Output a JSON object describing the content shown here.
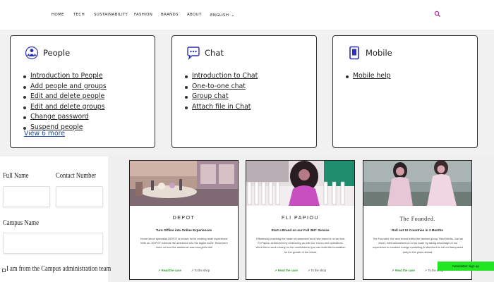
{
  "nav": {
    "items": [
      "HOME",
      "TECH",
      "SUSTAINABILITY",
      "FASHION",
      "BRANDS",
      "ABOUT"
    ],
    "language": "ENGLISH",
    "icons": {
      "search": "search-icon",
      "language": "chevron-down-icon"
    }
  },
  "help": {
    "cards": [
      {
        "title": "People",
        "icon": "people-icon",
        "links": [
          "Introduction to People",
          "Add people and groups",
          "Edit and delete people",
          "Edit and delete groups",
          "Change password",
          "Suspend people"
        ],
        "more": "View 6 more"
      },
      {
        "title": "Chat",
        "icon": "chat-bubble-icon",
        "links": [
          "Introduction to Chat",
          "One-to-one chat",
          "Group chat",
          "Attach file in Chat"
        ]
      },
      {
        "title": "Mobile",
        "icon": "mobile-icon",
        "links": [
          "Mobile help"
        ]
      }
    ]
  },
  "form": {
    "full_name": "Full Name",
    "contact_number": "Contact Number",
    "campus_name": "Campus Name",
    "admin_checkbox": "I am from the Campus administration team"
  },
  "brands": [
    {
      "name": "DEPOT",
      "tagline": "Turn Offline into Online Experiences",
      "description": "Home decor specialist DEPOT is known for its exciting retail experience. With an, DEPOT extends the ambience into the digital world. Read here more on how the ambience was brought to life!",
      "read_label": "Read the case",
      "shop_label": "To the shop"
    },
    {
      "name": "FLI PAPIOU",
      "tagline": "Start a Brand on our Full 360° Service",
      "description": "Effortlessly reaching the heart of customers as a new brand is no an feat. Fli Papiou achieved it by embracing us with our end-to-end operations. We'd like to work closely on the omnichannel you can build the foundation for the growth of the future.",
      "read_label": "Read the case",
      "shop_label": "To the shop"
    },
    {
      "name": "The Founded.",
      "tagline": "Roll out 10 Countries in 3 Months",
      "description": "The Founded, the new brand within the fashion group, Best Medis, Just as Jewel, internationalized on a top scale by taking advantage of our experience to combine foreign marketing & storefront to roll out fast-paced early in the years ahead.",
      "read_label": "Read the case",
      "shop_label": "To the shop"
    }
  ],
  "newsletter": "Newsletter sign up",
  "colors": {
    "accent": "#2e9b2e",
    "newsletter_bg": "#22e622",
    "link_blue": "#1b4a9c",
    "search": "#b01e9a"
  }
}
